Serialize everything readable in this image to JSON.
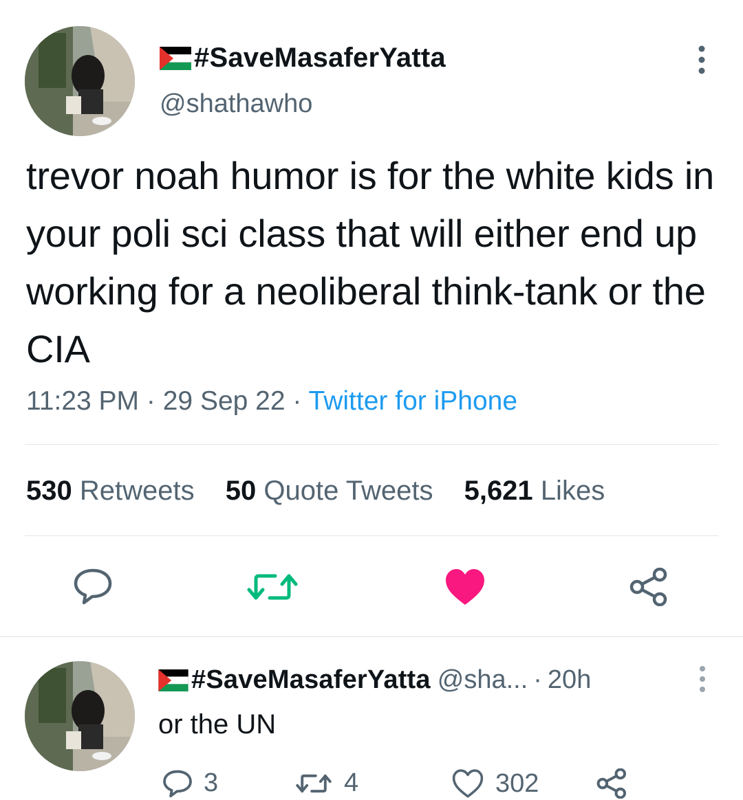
{
  "tweet": {
    "display_name": "#SaveMasaferYatta",
    "handle": "@shathawho",
    "text": "trevor noah humor is for the white kids in your poli sci class that will either end up working for a neoliberal think-tank or the CIA",
    "time": "11:23 PM",
    "date": "29 Sep 22",
    "separator": "·",
    "source": "Twitter for iPhone",
    "stats": {
      "retweets_count": "530",
      "retweets_label": "Retweets",
      "quotes_count": "50",
      "quotes_label": "Quote Tweets",
      "likes_count": "5,621",
      "likes_label": "Likes"
    },
    "actions": {
      "reply_icon": "reply-icon",
      "retweet_icon": "retweet-icon",
      "like_icon": "heart-filled-icon",
      "share_icon": "share-icon"
    }
  },
  "reply": {
    "display_name": "#SaveMasaferYatta",
    "handle": "@sha...",
    "separator": "·",
    "time": "20h",
    "text": "or the UN",
    "reply_count": "3",
    "retweet_count": "4",
    "like_count": "302"
  },
  "colors": {
    "text": "#0f1419",
    "muted": "#536471",
    "link": "#1d9bf0",
    "retweet_green": "#00ba7c",
    "like_pink": "#f91880",
    "divider": "#e1e6ea"
  }
}
